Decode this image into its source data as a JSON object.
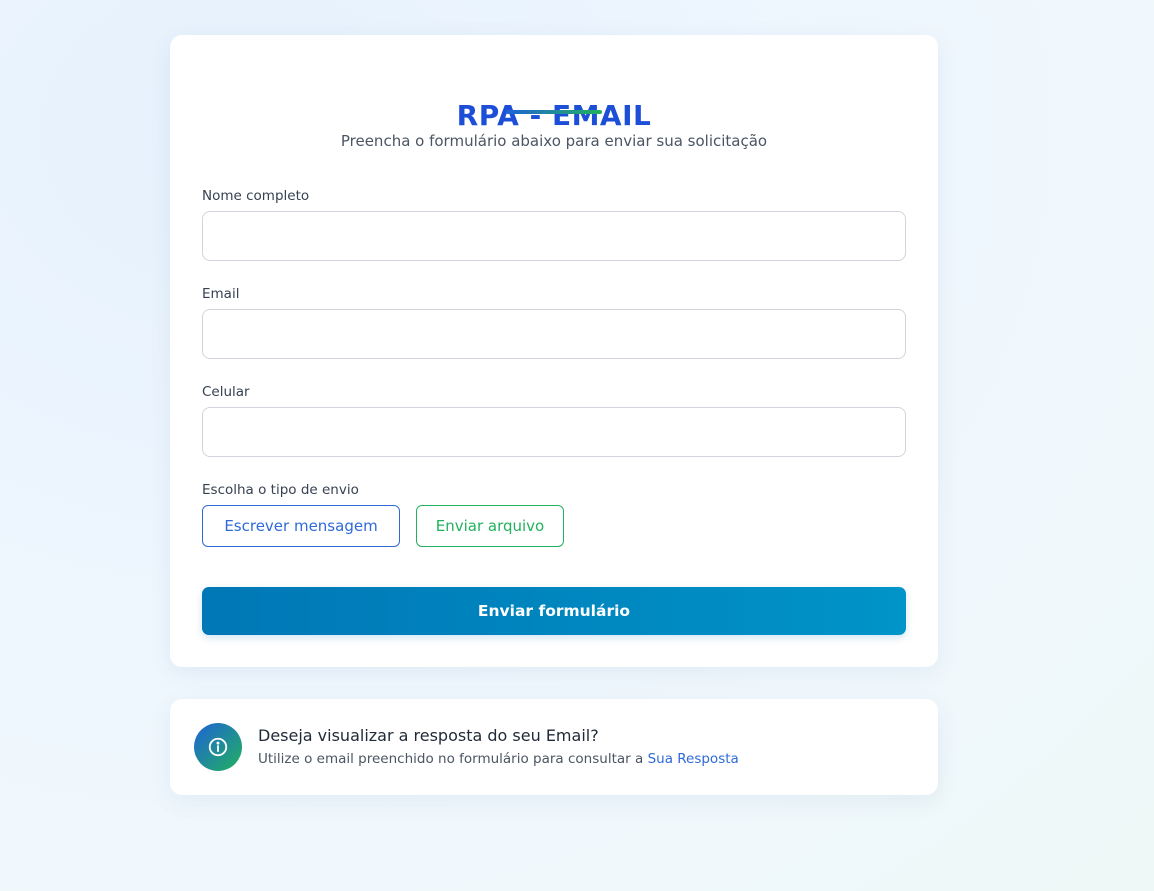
{
  "form": {
    "title": "RPA - EMAIL",
    "subtitle": "Preencha o formulário abaixo para enviar sua solicitação",
    "fields": {
      "name": {
        "label": "Nome completo",
        "value": ""
      },
      "email": {
        "label": "Email",
        "value": ""
      },
      "phone": {
        "label": "Celular",
        "value": ""
      }
    },
    "send_type": {
      "label": "Escolha o tipo de envio",
      "write_message": "Escrever mensagem",
      "send_file": "Enviar arquivo"
    },
    "submit_label": "Enviar formulário"
  },
  "info": {
    "icon": "info-icon",
    "title": "Deseja visualizar a resposta do seu Email?",
    "text": "Utilize o email preenchido no formulário para consultar a",
    "link_label": "Sua Resposta"
  },
  "colors": {
    "accent_blue": "#1d4ed8",
    "accent_green": "#22b15e",
    "submit": "#0077b6"
  }
}
